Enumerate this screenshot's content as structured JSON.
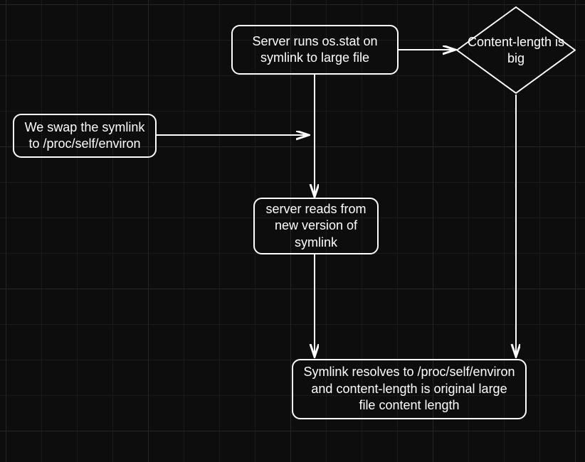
{
  "nodes": {
    "stat": "Server runs os.stat on symlink to large file",
    "swap": "We swap the symlink to /proc/self/environ",
    "reads": "server reads from new version of symlink",
    "result": "Symlink resolves to /proc/self/environ and content-length is original large file content length",
    "content_length": "Content-length is big"
  },
  "diagram": {
    "type": "flowchart",
    "edges": [
      [
        "stat",
        "content_length"
      ],
      [
        "stat",
        "reads"
      ],
      [
        "swap",
        "reads"
      ],
      [
        "reads",
        "result"
      ],
      [
        "content_length",
        "result"
      ]
    ]
  }
}
